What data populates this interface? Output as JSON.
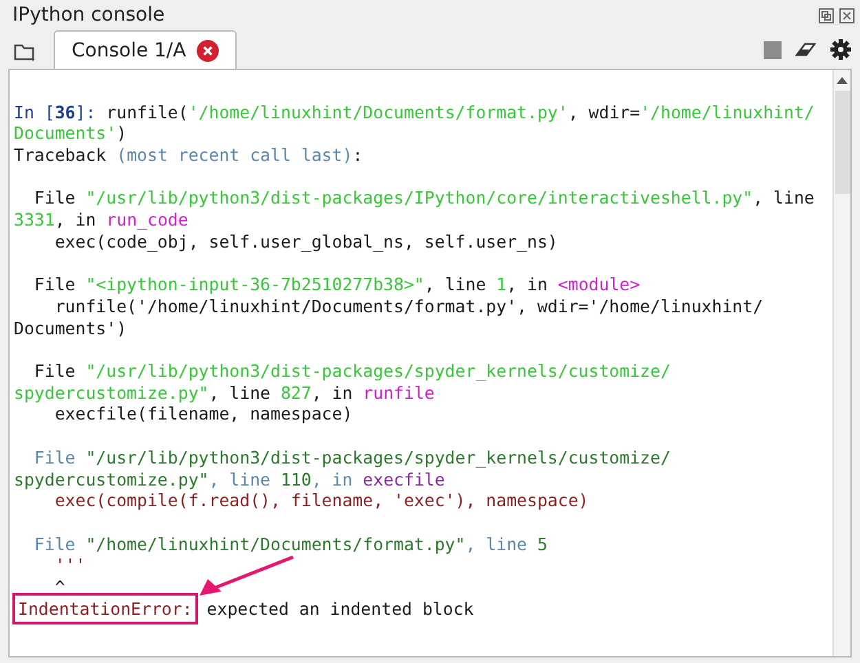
{
  "pane": {
    "title": "IPython console"
  },
  "tabs": [
    {
      "label": "Console 1/A",
      "selected": true
    }
  ],
  "console": {
    "lines": [
      {
        "kind": "blank"
      },
      {
        "segments": [
          {
            "kind": "prompt",
            "text": "In ["
          },
          {
            "kind": "prompt-num",
            "text": "36"
          },
          {
            "kind": "prompt",
            "text": "]: "
          },
          {
            "kind": "plain",
            "text": "runfile("
          },
          {
            "kind": "string",
            "text": "'/home/linuxhint/Documents/format.py'"
          },
          {
            "kind": "plain",
            "text": ", wdir="
          },
          {
            "kind": "string",
            "text": "'/home/linuxhint/"
          }
        ]
      },
      {
        "segments": [
          {
            "kind": "string",
            "text": "Documents'"
          },
          {
            "kind": "plain",
            "text": ")"
          }
        ]
      },
      {
        "segments": [
          {
            "kind": "plain",
            "text": "Traceback "
          },
          {
            "kind": "hint",
            "text": "(most recent call last)"
          },
          {
            "kind": "plain",
            "text": ":"
          }
        ]
      },
      {
        "kind": "blank"
      },
      {
        "segments": [
          {
            "kind": "plain",
            "text": "  File "
          },
          {
            "kind": "string",
            "text": "\"/usr/lib/python3/dist-packages/IPython/core/interactiveshell.py\""
          },
          {
            "kind": "plain",
            "text": ", line"
          }
        ]
      },
      {
        "segments": [
          {
            "kind": "string",
            "text": "3331"
          },
          {
            "kind": "plain",
            "text": ", in "
          },
          {
            "kind": "name",
            "text": "run_code"
          }
        ]
      },
      {
        "segments": [
          {
            "kind": "plain",
            "text": "    exec(code_obj, self.user_global_ns, self.user_ns)"
          }
        ]
      },
      {
        "kind": "blank"
      },
      {
        "segments": [
          {
            "kind": "plain",
            "text": "  File "
          },
          {
            "kind": "string",
            "text": "\"<ipython-input-36-7b2510277b38>\""
          },
          {
            "kind": "plain",
            "text": ", line "
          },
          {
            "kind": "string",
            "text": "1"
          },
          {
            "kind": "plain",
            "text": ", in "
          },
          {
            "kind": "name",
            "text": "<module>"
          }
        ]
      },
      {
        "segments": [
          {
            "kind": "plain",
            "text": "    runfile('/home/linuxhint/Documents/format.py', wdir='/home/linuxhint/"
          }
        ]
      },
      {
        "segments": [
          {
            "kind": "plain",
            "text": "Documents')"
          }
        ]
      },
      {
        "kind": "blank"
      },
      {
        "segments": [
          {
            "kind": "plain",
            "text": "  File "
          },
          {
            "kind": "string",
            "text": "\"/usr/lib/python3/dist-packages/spyder_kernels/customize/"
          }
        ]
      },
      {
        "segments": [
          {
            "kind": "string",
            "text": "spydercustomize.py\""
          },
          {
            "kind": "plain",
            "text": ", line "
          },
          {
            "kind": "string",
            "text": "827"
          },
          {
            "kind": "plain",
            "text": ", in "
          },
          {
            "kind": "name",
            "text": "runfile"
          }
        ]
      },
      {
        "segments": [
          {
            "kind": "plain",
            "text": "    execfile(filename, namespace)"
          }
        ]
      },
      {
        "kind": "blank"
      },
      {
        "segments": [
          {
            "kind": "hint",
            "text": "  File "
          },
          {
            "kind": "dim-string",
            "text": "\"/usr/lib/python3/dist-packages/spyder_kernels/customize/"
          }
        ]
      },
      {
        "segments": [
          {
            "kind": "dim-string",
            "text": "spydercustomize.py\""
          },
          {
            "kind": "hint",
            "text": ", line "
          },
          {
            "kind": "dim-string",
            "text": "110"
          },
          {
            "kind": "hint",
            "text": ", in "
          },
          {
            "kind": "dim-name",
            "text": "execfile"
          }
        ]
      },
      {
        "segments": [
          {
            "kind": "code",
            "text": "    exec(compile(f.read(), filename, 'exec'), namespace)"
          }
        ]
      },
      {
        "kind": "blank"
      },
      {
        "segments": [
          {
            "kind": "hint",
            "text": "  File "
          },
          {
            "kind": "dim-string",
            "text": "\"/home/linuxhint/Documents/format.py\""
          },
          {
            "kind": "hint",
            "text": ", line "
          },
          {
            "kind": "dim-string",
            "text": "5"
          }
        ]
      },
      {
        "segments": [
          {
            "kind": "code",
            "text": "    '''"
          }
        ]
      },
      {
        "segments": [
          {
            "kind": "plain",
            "text": "    ^"
          }
        ]
      },
      {
        "segments": [
          {
            "kind": "error",
            "text": "IndentationError:"
          },
          {
            "kind": "plain",
            "text": " expected an indented block"
          }
        ]
      }
    ]
  }
}
